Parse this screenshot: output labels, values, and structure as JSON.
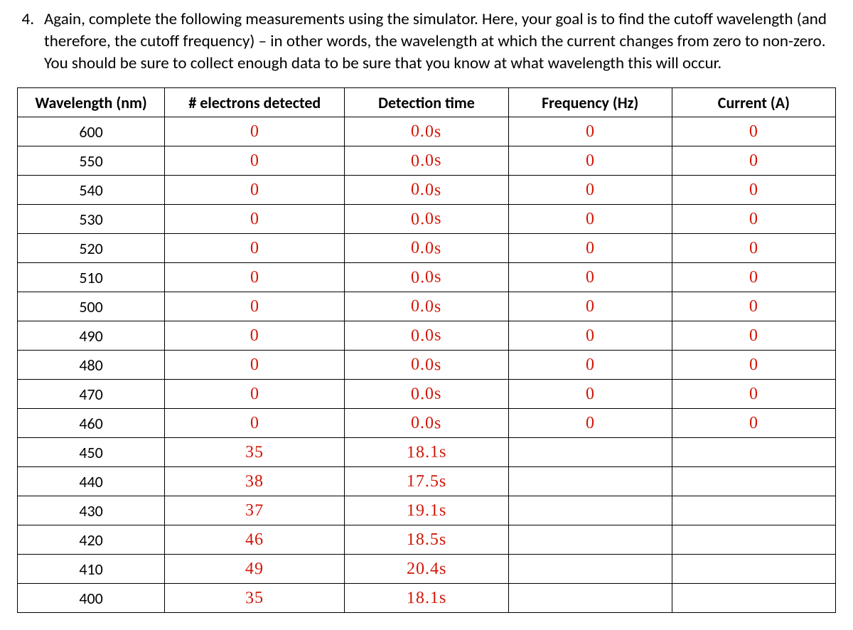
{
  "question": {
    "number": "4.",
    "text": "Again, complete the following measurements using the simulator. Here, your goal is to find the cutoff wavelength (and therefore, the cutoff frequency) – in other words, the wavelength at which the current changes from zero to non-zero. You should be sure to collect enough data to be sure that you know at what wavelength this will occur."
  },
  "headers": {
    "wavelength": "Wavelength (nm)",
    "electrons": "# electrons detected",
    "time": "Detection time",
    "frequency": "Frequency (Hz)",
    "current": "Current (A)"
  },
  "rows": [
    {
      "wavelength": "600",
      "electrons": "0",
      "time": "0.0s",
      "frequency": "0",
      "current": "0"
    },
    {
      "wavelength": "550",
      "electrons": "0",
      "time": "0.0s",
      "frequency": "0",
      "current": "0"
    },
    {
      "wavelength": "540",
      "electrons": "0",
      "time": "0.0s",
      "frequency": "0",
      "current": "0"
    },
    {
      "wavelength": "530",
      "electrons": "0",
      "time": "0.0s",
      "frequency": "0",
      "current": "0"
    },
    {
      "wavelength": "520",
      "electrons": "0",
      "time": "0.0s",
      "frequency": "0",
      "current": "0"
    },
    {
      "wavelength": "510",
      "electrons": "0",
      "time": "0.0s",
      "frequency": "0",
      "current": "0"
    },
    {
      "wavelength": "500",
      "electrons": "0",
      "time": "0.0s",
      "frequency": "0",
      "current": "0"
    },
    {
      "wavelength": "490",
      "electrons": "0",
      "time": "0.0s",
      "frequency": "0",
      "current": "0"
    },
    {
      "wavelength": "480",
      "electrons": "0",
      "time": "0.0s",
      "frequency": "0",
      "current": "0"
    },
    {
      "wavelength": "470",
      "electrons": "0",
      "time": "0.0s",
      "frequency": "0",
      "current": "0"
    },
    {
      "wavelength": "460",
      "electrons": "0",
      "time": "0.0s",
      "frequency": "0",
      "current": "0"
    },
    {
      "wavelength": "450",
      "electrons": "35",
      "time": "18.1s",
      "frequency": "",
      "current": ""
    },
    {
      "wavelength": "440",
      "electrons": "38",
      "time": "17.5s",
      "frequency": "",
      "current": ""
    },
    {
      "wavelength": "430",
      "electrons": "37",
      "time": "19.1s",
      "frequency": "",
      "current": ""
    },
    {
      "wavelength": "420",
      "electrons": "46",
      "time": "18.5s",
      "frequency": "",
      "current": ""
    },
    {
      "wavelength": "410",
      "electrons": "49",
      "time": "20.4s",
      "frequency": "",
      "current": ""
    },
    {
      "wavelength": "400",
      "electrons": "35",
      "time": "18.1s",
      "frequency": "",
      "current": ""
    }
  ],
  "chart_data": {
    "type": "table",
    "title": "Photoelectric cutoff wavelength measurements",
    "columns": [
      "Wavelength (nm)",
      "# electrons detected",
      "Detection time",
      "Frequency (Hz)",
      "Current (A)"
    ],
    "data": [
      [
        600,
        0,
        "0.0s",
        0,
        0
      ],
      [
        550,
        0,
        "0.0s",
        0,
        0
      ],
      [
        540,
        0,
        "0.0s",
        0,
        0
      ],
      [
        530,
        0,
        "0.0s",
        0,
        0
      ],
      [
        520,
        0,
        "0.0s",
        0,
        0
      ],
      [
        510,
        0,
        "0.0s",
        0,
        0
      ],
      [
        500,
        0,
        "0.0s",
        0,
        0
      ],
      [
        490,
        0,
        "0.0s",
        0,
        0
      ],
      [
        480,
        0,
        "0.0s",
        0,
        0
      ],
      [
        470,
        0,
        "0.0s",
        0,
        0
      ],
      [
        460,
        0,
        "0.0s",
        0,
        0
      ],
      [
        450,
        35,
        "18.1s",
        null,
        null
      ],
      [
        440,
        38,
        "17.5s",
        null,
        null
      ],
      [
        430,
        37,
        "19.1s",
        null,
        null
      ],
      [
        420,
        46,
        "18.5s",
        null,
        null
      ],
      [
        410,
        49,
        "20.4s",
        null,
        null
      ],
      [
        400,
        35,
        "18.1s",
        null,
        null
      ]
    ]
  }
}
